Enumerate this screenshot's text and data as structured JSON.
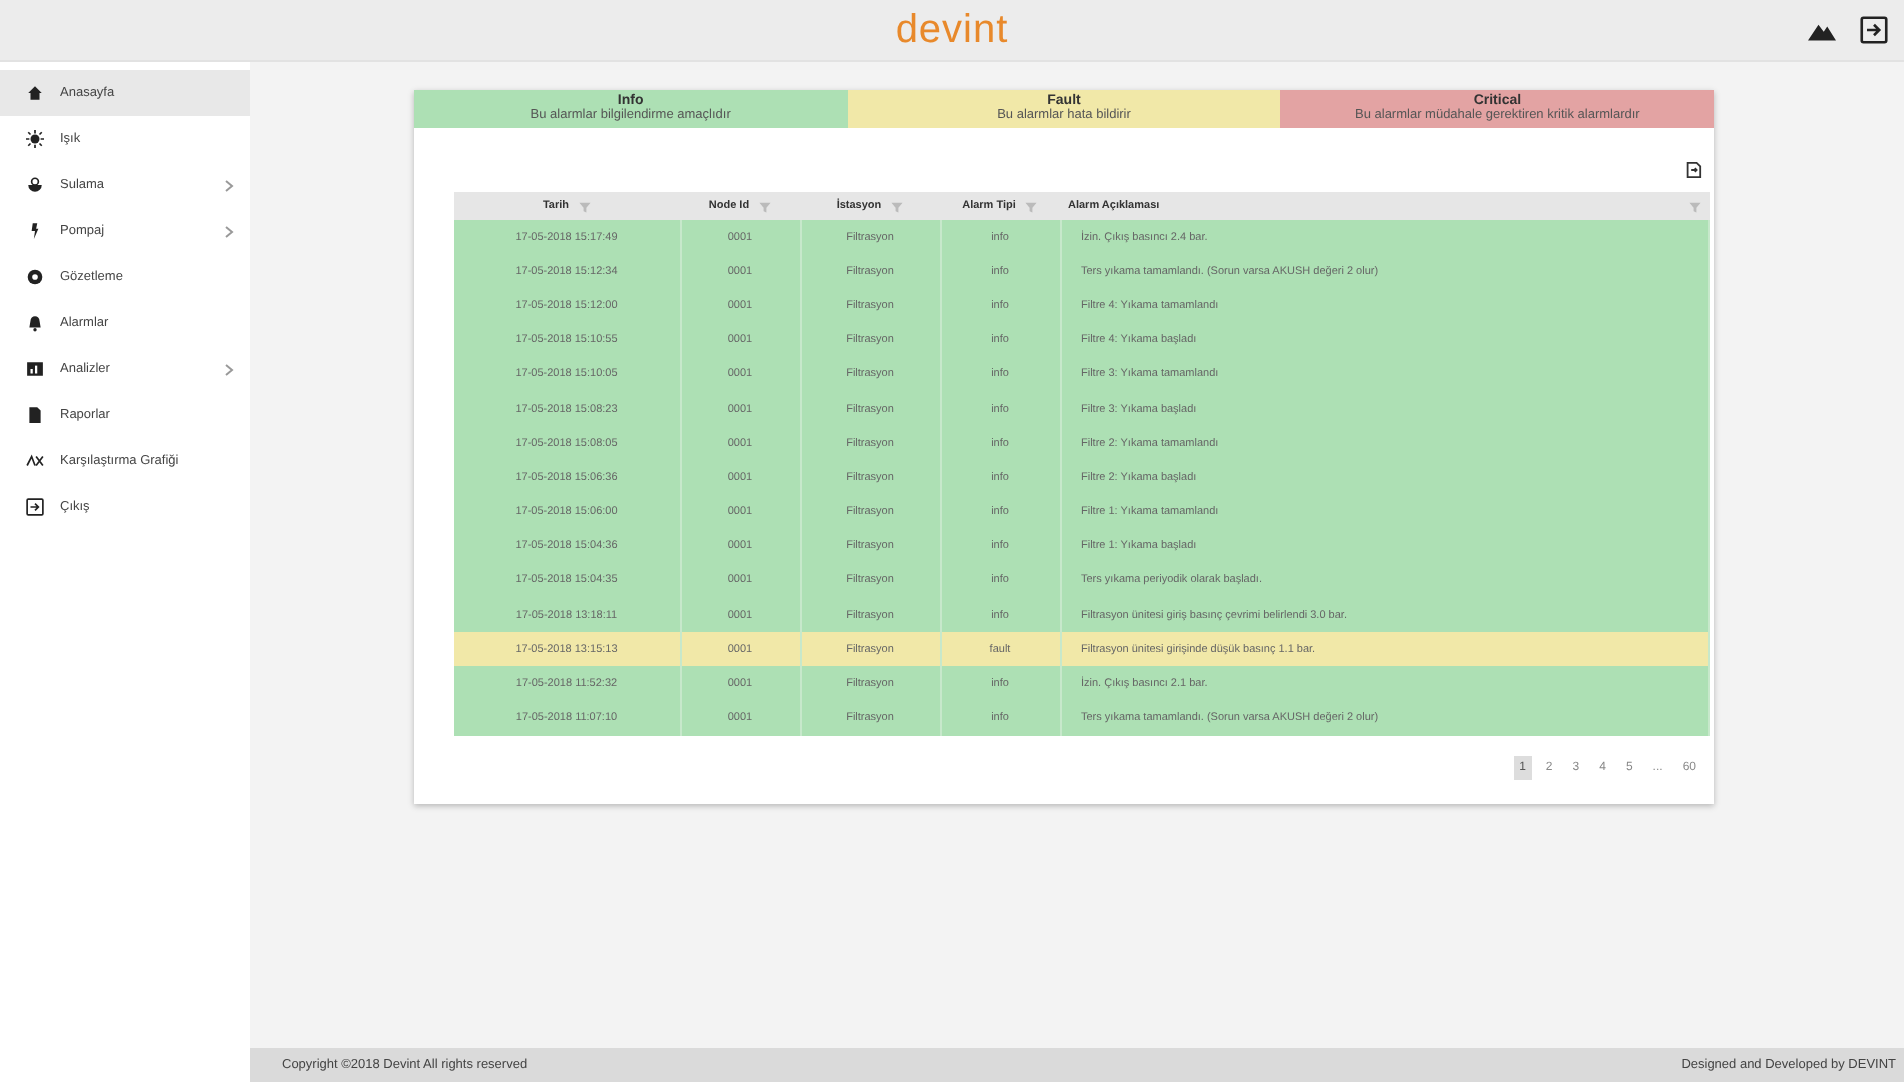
{
  "header": {
    "logo": "devint"
  },
  "sidebar": {
    "items": [
      {
        "label": "Anasayfa",
        "selected": true,
        "has_submenu": false
      },
      {
        "label": "Işık",
        "selected": false,
        "has_submenu": false
      },
      {
        "label": "Sulama",
        "selected": false,
        "has_submenu": true
      },
      {
        "label": "Pompaj",
        "selected": false,
        "has_submenu": true
      },
      {
        "label": "Gözetleme",
        "selected": false,
        "has_submenu": false
      },
      {
        "label": "Alarmlar",
        "selected": false,
        "has_submenu": false
      },
      {
        "label": "Analizler",
        "selected": false,
        "has_submenu": true
      },
      {
        "label": "Raporlar",
        "selected": false,
        "has_submenu": false
      },
      {
        "label": "Karşılaştırma Grafiği",
        "selected": false,
        "has_submenu": false
      },
      {
        "label": "Çıkış",
        "selected": false,
        "has_submenu": false
      }
    ]
  },
  "legend": [
    {
      "kind": "info",
      "title": "Info",
      "text": "Bu alarmlar bilgilendirme amaçlıdır"
    },
    {
      "kind": "fault",
      "title": "Fault",
      "text": "Bu alarmlar hata bildirir"
    },
    {
      "kind": "critical",
      "title": "Critical",
      "text": "Bu alarmlar müdahale gerektiren kritik alarmlardır"
    }
  ],
  "table": {
    "columns": [
      "Tarih",
      "Node Id",
      "İstasyon",
      "Alarm Tipi",
      "Alarm Açıklaması"
    ],
    "rows": [
      {
        "kind": "info",
        "cells": [
          "17-05-2018 15:17:49",
          "0001",
          "Filtrasyon",
          "info",
          "İzin. Çıkış basıncı 2.4 bar."
        ]
      },
      {
        "kind": "info",
        "cells": [
          "17-05-2018 15:12:34",
          "0001",
          "Filtrasyon",
          "info",
          "Ters yıkama tamamlandı. (Sorun varsa AKUSH değeri 2 olur)"
        ]
      },
      {
        "kind": "info",
        "cells": [
          "17-05-2018 15:12:00",
          "0001",
          "Filtrasyon",
          "info",
          "Filtre 4: Yıkama tamamlandı"
        ]
      },
      {
        "kind": "info",
        "cells": [
          "17-05-2018 15:10:55",
          "0001",
          "Filtrasyon",
          "info",
          "Filtre 4: Yıkama başladı"
        ]
      },
      {
        "kind": "info",
        "cells": [
          "17-05-2018 15:10:05",
          "0001",
          "Filtrasyon",
          "info",
          "Filtre 3: Yıkama tamamlandı"
        ]
      },
      {
        "kind": "info",
        "cells": [
          "17-05-2018 15:08:23",
          "0001",
          "Filtrasyon",
          "info",
          "Filtre 3: Yıkama başladı"
        ]
      },
      {
        "kind": "info",
        "cells": [
          "17-05-2018 15:08:05",
          "0001",
          "Filtrasyon",
          "info",
          "Filtre 2: Yıkama tamamlandı"
        ]
      },
      {
        "kind": "info",
        "cells": [
          "17-05-2018 15:06:36",
          "0001",
          "Filtrasyon",
          "info",
          "Filtre 2: Yıkama başladı"
        ]
      },
      {
        "kind": "info",
        "cells": [
          "17-05-2018 15:06:00",
          "0001",
          "Filtrasyon",
          "info",
          "Filtre 1: Yıkama tamamlandı"
        ]
      },
      {
        "kind": "info",
        "cells": [
          "17-05-2018 15:04:36",
          "0001",
          "Filtrasyon",
          "info",
          "Filtre 1: Yıkama başladı"
        ]
      },
      {
        "kind": "info",
        "cells": [
          "17-05-2018 15:04:35",
          "0001",
          "Filtrasyon",
          "info",
          "Ters yıkama periyodik olarak başladı."
        ]
      },
      {
        "kind": "info",
        "cells": [
          "17-05-2018 13:18:11",
          "0001",
          "Filtrasyon",
          "info",
          "Filtrasyon ünitesi giriş basınç çevrimi belirlendi 3.0 bar."
        ]
      },
      {
        "kind": "fault",
        "cells": [
          "17-05-2018 13:15:13",
          "0001",
          "Filtrasyon",
          "fault",
          "Filtrasyon ünitesi girişinde düşük basınç 1.1 bar."
        ]
      },
      {
        "kind": "info",
        "cells": [
          "17-05-2018 11:52:32",
          "0001",
          "Filtrasyon",
          "info",
          "İzin. Çıkış basıncı 2.1 bar."
        ]
      },
      {
        "kind": "info",
        "cells": [
          "17-05-2018 11:07:10",
          "0001",
          "Filtrasyon",
          "info",
          "Ters yıkama tamamlandı. (Sorun varsa AKUSH değeri 2 olur)"
        ]
      }
    ]
  },
  "pagination": [
    {
      "label": "1",
      "selected": true
    },
    {
      "label": "2",
      "selected": false
    },
    {
      "label": "3",
      "selected": false
    },
    {
      "label": "4",
      "selected": false
    },
    {
      "label": "5",
      "selected": false
    },
    {
      "label": "...",
      "selected": false
    },
    {
      "label": "60",
      "selected": false
    }
  ],
  "footer": {
    "copyright": "Copyright ©2018 Devint All rights reserved",
    "credit": "Designed and Developed by DEVINT"
  }
}
